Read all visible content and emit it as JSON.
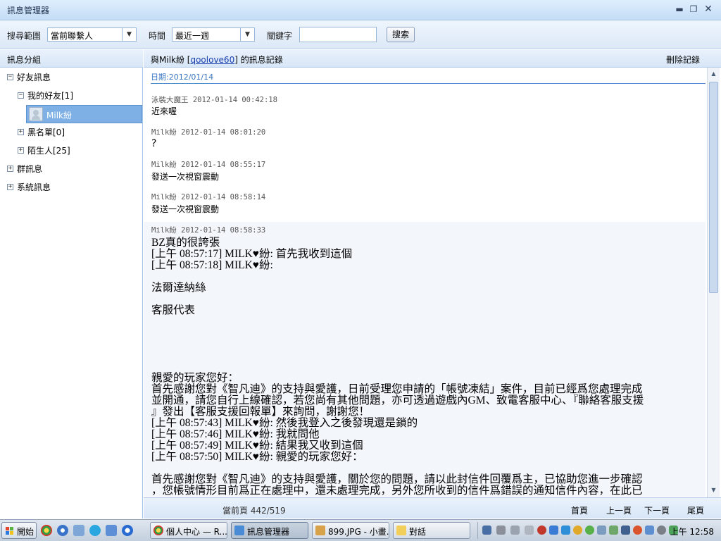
{
  "window": {
    "title": "訊息管理器"
  },
  "toolbar": {
    "scope_label": "搜尋範圍",
    "scope_value": "當前聯繫人",
    "time_label": "時間",
    "time_value": "最近一週",
    "keyword_label": "關鍵字",
    "keyword_value": "",
    "search_label": "搜索"
  },
  "sidebar": {
    "header": "訊息分組",
    "tree": [
      {
        "label": "好友訊息",
        "toggle": "−"
      },
      {
        "label": "我的好友[1]",
        "toggle": "−"
      },
      {
        "label": "Milk紛",
        "toggle": ""
      },
      {
        "label": "黑名單[0]",
        "toggle": "+"
      },
      {
        "label": "陌生人[25]",
        "toggle": "+"
      },
      {
        "label": "群訊息",
        "toggle": "+"
      },
      {
        "label": "系統訊息",
        "toggle": "+"
      }
    ]
  },
  "conversation": {
    "title_prefix": "與Milk紛 [",
    "title_link": "qoolove60",
    "title_suffix": "] 的訊息記錄",
    "delete_label": "刪除記錄",
    "date": "日期:2012/01/14",
    "messages": [
      {
        "sender": "泳裝大魔王",
        "time": "2012-01-14 00:42:18",
        "text": "近來喔"
      },
      {
        "sender": "Milk紛",
        "time": "2012-01-14 08:01:20",
        "text": "?"
      },
      {
        "sender": "Milk紛",
        "time": "2012-01-14 08:55:17",
        "text": "發送一次視窗震動"
      },
      {
        "sender": "Milk紛",
        "time": "2012-01-14 08:58:14",
        "text": "發送一次視窗震動"
      },
      {
        "sender": "Milk紛",
        "time": "2012-01-14 08:58:33",
        "text": ""
      }
    ],
    "long_message_lines": [
      "BZ真的很誇張",
      "[上午 08:57:17] MILK♥紛: 首先我收到這個",
      "[上午 08:57:18] MILK♥紛:",
      "",
      "法爾達納絲",
      "",
      "客服代表",
      "",
      "",
      "",
      "",
      "",
      "親愛的玩家您好：",
      "首先感謝您對《智凡迪》的支持與愛護，日前受理您申請的「帳號凍結」案件，目前已經爲您處理完成",
      "並開通，請您自行上線確認，若您尚有其他問題，亦可透過遊戲內GM、致電客服中心、『聯絡客服支援",
      "』發出【客服支援回報單】來詢問，謝謝您！",
      "[上午 08:57:43] MILK♥紛: 然後我登入之後發現還是鎖的",
      "[上午 08:57:46] MILK♥紛: 我就問他",
      "[上午 08:57:49] MILK♥紛: 結果我又收到這個",
      "[上午 08:57:50] MILK♥紛: 親愛的玩家您好：",
      "",
      "首先感謝您對《智凡迪》的支持與愛護，關於您的問題，請以此封信件回覆爲主，已協助您進一步確認",
      "，您帳號情形目前爲正在處理中，還未處理完成，另外您所收到的信件爲錯誤的通知信件內容，在此已"
    ]
  },
  "footer": {
    "page_info": "當前頁 442/519",
    "first": "首頁",
    "prev": "上一頁",
    "next": "下一頁",
    "last": "尾頁"
  },
  "taskbar": {
    "start_label": "開始",
    "tasks": [
      {
        "label": "個人中心 — R...",
        "icon": "chrome-icon"
      },
      {
        "label": "訊息管理器",
        "icon": "qq-icon"
      },
      {
        "label": "899.JPG - 小畫...",
        "icon": "paint-icon"
      },
      {
        "label": "對話",
        "icon": "folder-icon"
      }
    ],
    "clock": "上午 12:58"
  }
}
